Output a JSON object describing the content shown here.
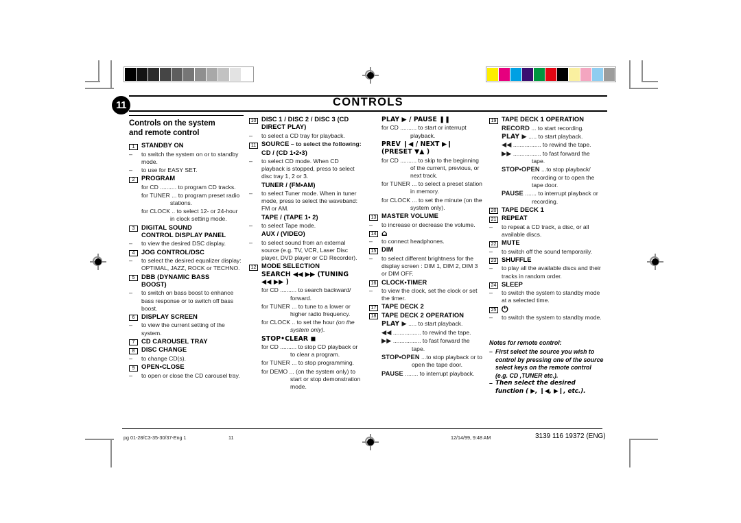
{
  "header": {
    "page_number": "11",
    "title": "CONTROLS"
  },
  "calibration": {
    "gray_strip": [
      "#000000",
      "#141414",
      "#2b2b2b",
      "#454545",
      "#5e5e5e",
      "#767676",
      "#8f8f8f",
      "#a8a8a8",
      "#c2c2c2",
      "#e3e3e3",
      "#ffffff"
    ],
    "color_strip": [
      "#fdee00",
      "#e6007e",
      "#00a0e3",
      "#3b0f70",
      "#009640",
      "#e30613",
      "#000000",
      "#faf0a0",
      "#f4a6c0",
      "#8fcdf0",
      "#9d9d9c"
    ]
  },
  "columns": [
    {
      "heading": "Controls on the system\nand remote control",
      "items": [
        {
          "num": "1",
          "title": "STANDBY ON",
          "lines": [
            {
              "kind": "dash",
              "text": "to switch the system on or to standby mode."
            },
            {
              "kind": "dash",
              "text": "to use for EASY SET."
            }
          ]
        },
        {
          "num": "2",
          "title": "PROGRAM",
          "lines": [
            {
              "kind": "hang",
              "text": "for CD .......... to program CD tracks."
            },
            {
              "kind": "hang",
              "text": "for TUNER ... to program preset radio stations."
            },
            {
              "kind": "hang",
              "text": "for CLOCK .. to select 12- or 24-hour in clock setting mode."
            }
          ]
        },
        {
          "num": "3",
          "title": "DIGITAL SOUND\nCONTROL DISPLAY PANEL",
          "lines": [
            {
              "kind": "dash",
              "text": "to view the desired DSC display."
            }
          ]
        },
        {
          "num": "4",
          "title": "JOG CONTROL/DSC",
          "lines": [
            {
              "kind": "dash",
              "text": "to select the desired equalizer display: OPTIMAL, JAZZ, ROCK or TECHNO."
            }
          ]
        },
        {
          "num": "5",
          "title": "DBB (DYNAMIC BASS\nBOOST)",
          "lines": [
            {
              "kind": "dash",
              "text": "to switch on bass boost to enhance bass response or to switch off bass boost."
            }
          ]
        },
        {
          "num": "6",
          "title": "DISPLAY SCREEN",
          "lines": [
            {
              "kind": "dash",
              "text": "to view the current setting of the system."
            }
          ]
        },
        {
          "num": "7",
          "title": "CD CAROUSEL TRAY",
          "lines": []
        },
        {
          "num": "8",
          "title": "DISC CHANGE",
          "lines": [
            {
              "kind": "dash",
              "text": "to change CD(s)."
            }
          ]
        },
        {
          "num": "9",
          "title": "OPEN•CLOSE",
          "lines": [
            {
              "kind": "dash",
              "text": "to open or close the CD carousel tray."
            }
          ]
        }
      ]
    },
    {
      "heading": "",
      "items": [
        {
          "num": "10",
          "title": "DISC 1 / DISC 2 / DISC 3 (CD\nDIRECT PLAY)",
          "lines": [
            {
              "kind": "dash",
              "text": "to select a CD tray for playback."
            }
          ]
        },
        {
          "num": "11",
          "title": "SOURCE",
          "title_suffix": " – to select the following:",
          "lines": [
            {
              "kind": "subbold",
              "text": "CD / (CD 1•2•3)"
            },
            {
              "kind": "dash",
              "text": "to select CD mode. When CD playback is stopped, press to select disc tray 1, 2 or 3."
            },
            {
              "kind": "subbold",
              "text": "TUNER / (FM•AM)"
            },
            {
              "kind": "dash",
              "text": "to select Tuner mode. When in tuner mode, press to select the waveband: FM or AM."
            },
            {
              "kind": "subbold",
              "text": "TAPE / (TAPE 1• 2)"
            },
            {
              "kind": "dash",
              "text": "to select Tape mode."
            },
            {
              "kind": "subbold",
              "text": "AUX / (VIDEO)"
            },
            {
              "kind": "dash",
              "text": "to select sound from an external source (e.g. TV, VCR, Laser Disc player, DVD player or CD Recorder)."
            }
          ]
        },
        {
          "num": "12",
          "title": "MODE SELECTION\nSEARCH ◀◀ ▶▶ (TUNING\n◀◀ ▶▶ )",
          "lines": [
            {
              "kind": "hang",
              "text": "for CD .......... to search backward/ forward."
            },
            {
              "kind": "hang",
              "text": "for TUNER ... to tune to a lower or higher radio frequency."
            },
            {
              "kind": "hang",
              "text": "for CLOCK .. to set the hour (on the system only).",
              "italic_tail": "(on the system only)."
            },
            {
              "kind": "subbold",
              "text": "STOP•CLEAR ◼"
            },
            {
              "kind": "hang",
              "text": "for CD .......... to stop CD playback or to clear a program."
            },
            {
              "kind": "hang",
              "text": "for TUNER ... to stop programming."
            },
            {
              "kind": "hang",
              "text": "for DEMO ... (on the system only) to start or stop demonstration mode."
            }
          ]
        }
      ]
    },
    {
      "heading": "",
      "items": [
        {
          "num": "",
          "title": "PLAY ▶ / PAUSE ❚❚",
          "lines": [
            {
              "kind": "hang",
              "text": "for CD .......... to start or interrupt playback."
            },
            {
              "kind": "subbold",
              "text": "PREV ❙◀ / NEXT ▶❙ (PRESET ▼▲ )"
            },
            {
              "kind": "hang",
              "text": "for CD .......... to skip to the beginning of the current, previous, or next track."
            },
            {
              "kind": "hang",
              "text": "for TUNER ... to select a preset station in memory."
            },
            {
              "kind": "hang",
              "text": "for CLOCK ... to set the minute (on the system only)."
            }
          ]
        },
        {
          "num": "13",
          "title": "MASTER VOLUME",
          "lines": [
            {
              "kind": "dash",
              "text": "to increase or decrease the volume."
            }
          ]
        },
        {
          "num": "14",
          "title": "⌂",
          "icon": "headphones-icon",
          "lines": [
            {
              "kind": "dash",
              "text": "to connect headphones."
            }
          ]
        },
        {
          "num": "15",
          "title": "DIM",
          "lines": [
            {
              "kind": "dash",
              "text": "to select different brightness for the display screen : DIM 1, DIM 2, DIM 3 or DIM OFF."
            }
          ]
        },
        {
          "num": "16",
          "title": "CLOCK•TIMER",
          "lines": [
            {
              "kind": "dash",
              "text": "to view the clock, set the clock or set the timer."
            }
          ]
        },
        {
          "num": "17",
          "title": "TAPE DECK 2",
          "lines": []
        },
        {
          "num": "18",
          "title": "TAPE DECK 2 OPERATION",
          "lines": [
            {
              "kind": "hang2",
              "text": "PLAY ▶  ..... to start playback.",
              "bold_head": "PLAY ▶"
            },
            {
              "kind": "hang2",
              "text": "◀◀ ................. to rewind the tape.",
              "bold_head": "◀◀"
            },
            {
              "kind": "hang2",
              "text": "▶▶ ................. to fast forward the tape.",
              "bold_head": "▶▶"
            },
            {
              "kind": "hang2",
              "text": "STOP•OPEN ...to stop playback or to open the tape door.",
              "bold_head": "STOP•OPEN"
            },
            {
              "kind": "hang2",
              "text": "PAUSE ........ to interrupt playback.",
              "bold_head": "PAUSE"
            }
          ]
        }
      ]
    },
    {
      "heading": "",
      "items": [
        {
          "num": "19",
          "title": "TAPE DECK 1 OPERATION",
          "lines": [
            {
              "kind": "hang2",
              "text": "RECORD ... to start recording.",
              "bold_head": "RECORD"
            },
            {
              "kind": "hang2",
              "text": "PLAY ▶  ..... to start playback.",
              "bold_head": "PLAY ▶"
            },
            {
              "kind": "hang2",
              "text": "◀◀ ................. to rewind the tape.",
              "bold_head": "◀◀"
            },
            {
              "kind": "hang2",
              "text": "▶▶ ................. to fast forward the tape.",
              "bold_head": "▶▶"
            },
            {
              "kind": "hang2",
              "text": "STOP•OPEN ...to stop playback/ recording or to open the tape door.",
              "bold_head": "STOP•OPEN"
            },
            {
              "kind": "hang2",
              "text": "PAUSE ....... to interrupt playback or recording.",
              "bold_head": "PAUSE"
            }
          ]
        },
        {
          "num": "20",
          "title": "TAPE DECK 1",
          "lines": []
        },
        {
          "num": "21",
          "title": "REPEAT",
          "lines": [
            {
              "kind": "dash",
              "text": "to repeat a CD track, a disc, or all available discs."
            }
          ]
        },
        {
          "num": "22",
          "title": "MUTE",
          "lines": [
            {
              "kind": "dash",
              "text": "to switch off the sound temporarily."
            }
          ]
        },
        {
          "num": "23",
          "title": "SHUFFLE",
          "lines": [
            {
              "kind": "dash",
              "text": "to play all the available discs and their tracks in random order."
            }
          ]
        },
        {
          "num": "24",
          "title": "SLEEP",
          "lines": [
            {
              "kind": "dash",
              "text": "to switch the system to standby mode at a selected time."
            }
          ]
        },
        {
          "num": "25",
          "title": "⏻",
          "icon": "power-standby-icon",
          "lines": [
            {
              "kind": "dash",
              "text": "to switch the system to standby mode."
            }
          ]
        }
      ],
      "notes": {
        "title": "Notes for remote control:",
        "bullets": [
          "First select the source you wish to control by pressing one of the source select keys on the remote control (e.g.  CD ,TUNER etc.).",
          "Then select the desired function ( ▶, ❙◀, ▶❙, etc.)."
        ]
      }
    }
  ],
  "footer": {
    "left": "pg 01-28/C3-35-30/37-Eng 1",
    "page": "11",
    "timestamp": "12/14/99, 9:48 AM",
    "doc_code": "3139 116 19372 (ENG)"
  }
}
